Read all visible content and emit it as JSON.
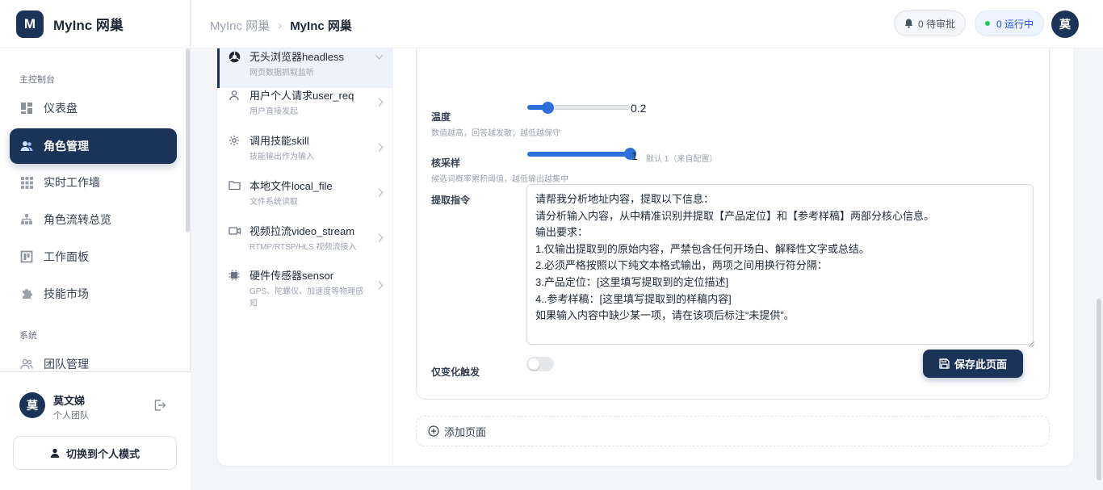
{
  "brand": {
    "logo_letter": "M",
    "name": "MyInc 网巢"
  },
  "sidebar": {
    "section_main": "主控制台",
    "section_system": "系统",
    "items": [
      {
        "label": "仪表盘",
        "icon": "dashboard-icon"
      },
      {
        "label": "角色管理",
        "icon": "users-icon",
        "active": true
      },
      {
        "label": "实时工作墙",
        "icon": "grid-icon"
      },
      {
        "label": "角色流转总览",
        "icon": "hierarchy-icon"
      },
      {
        "label": "工作面板",
        "icon": "panel-icon"
      },
      {
        "label": "技能市场",
        "icon": "puzzle-icon"
      },
      {
        "label": "团队管理",
        "icon": "team-icon"
      }
    ],
    "user": {
      "avatar": "莫",
      "name": "莫文娣",
      "team": "个人团队"
    },
    "switch_label": "切换到个人模式"
  },
  "header": {
    "breadcrumb": [
      "MyInc 网巢",
      "MyInc 网巢"
    ],
    "pending": "0 待审批",
    "running": "0 运行中",
    "avatar": "莫"
  },
  "list": [
    {
      "title": "无头浏览器headless",
      "sub": "网页数据抓取监听",
      "icon": "browser-icon",
      "selected": true
    },
    {
      "title": "用户个人请求user_req",
      "sub": "用户直接发起",
      "icon": "user-icon"
    },
    {
      "title": "调用技能skill",
      "sub": "技能输出作为输入",
      "icon": "gear-icon"
    },
    {
      "title": "本地文件local_file",
      "sub": "文件系统读取",
      "icon": "folder-icon"
    },
    {
      "title": "视频拉流video_stream",
      "sub": "RTMP/RTSP/HLS 视频流接入",
      "icon": "video-icon"
    },
    {
      "title": "硬件传感器sensor",
      "sub": "GPS、陀螺仪、加速度等物理感知",
      "icon": "chip-icon"
    }
  ],
  "form": {
    "temperature": {
      "label": "温度",
      "hint": "数值越高，回答越发散；越低越保守",
      "value": "0.2",
      "fraction": 0.2
    },
    "top_p": {
      "label": "核采样",
      "hint": "候选词概率累积阈值，越低输出越集中",
      "value": "1",
      "fraction": 1.0,
      "default_note": "默认 1（来自配置）"
    },
    "prompt": {
      "label": "提取指令",
      "value": "请帮我分析地址内容，提取以下信息：\n请分析输入内容，从中精准识别并提取【产品定位】和【参考样稿】两部分核心信息。\n输出要求：\n1.仅输出提取到的原始内容，严禁包含任何开场白、解释性文字或总结。\n2.必须严格按照以下纯文本格式输出，两项之间用换行符分隔：\n3.产品定位：[这里填写提取到的定位描述]\n4..参考样稿：[这里填写提取到的样稿内容]\n如果输入内容中缺少某一项，请在该项后标注“未提供”。"
    },
    "trigger": {
      "label": "仅变化触发",
      "on": false
    },
    "save_label": "保存此页面"
  },
  "add_page_label": "添加页面"
}
